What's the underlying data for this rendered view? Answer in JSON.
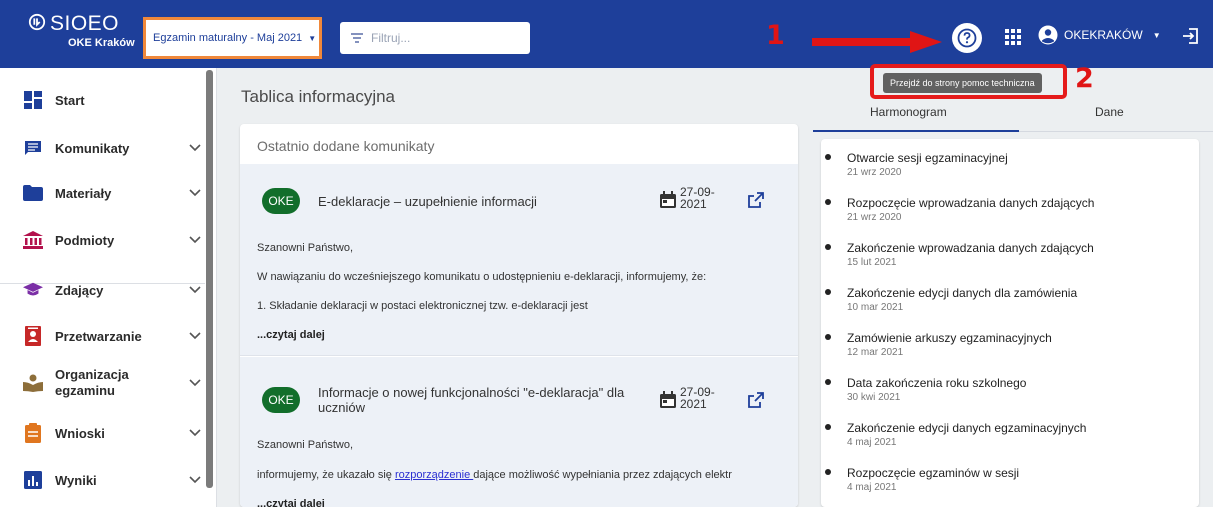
{
  "header": {
    "logo_title": "SIOEO",
    "logo_subtitle": "OKE Kraków",
    "exam_select": "Egzamin maturalny - Maj 2021",
    "filter_placeholder": "Filtruj...",
    "user_label": "OKEKRAKÓW",
    "annotation_1": "1",
    "annotation_2": "2",
    "help_tooltip": "Przejdź do strony pomoc techniczna",
    "colors": {
      "bar": "#1e3f9a",
      "highlight": "#e51b1b",
      "select_border": "#f0883a"
    }
  },
  "sidebar": {
    "items": [
      {
        "label": "Start",
        "icon": "dashboard-icon"
      },
      {
        "label": "Komunikaty",
        "icon": "message-icon"
      },
      {
        "label": "Materiały",
        "icon": "folder-icon"
      },
      {
        "label": "Podmioty",
        "icon": "institution-icon"
      },
      {
        "label": "Zdający",
        "icon": "graduation-cap-icon"
      },
      {
        "label": "Przetwarzanie",
        "icon": "contact-card-icon"
      },
      {
        "label": "Organizacja egzaminu",
        "label_line1": "Organizacja",
        "label_line2": "egzaminu",
        "icon": "reader-icon"
      },
      {
        "label": "Wnioski",
        "icon": "clipboard-icon"
      },
      {
        "label": "Wyniki",
        "icon": "bar-chart-icon"
      }
    ]
  },
  "main": {
    "page_title": "Tablica informacyjna",
    "panel_title": "Ostatnio dodane komunikaty",
    "cards": [
      {
        "badge": "OKE",
        "title": "E-deklaracje – uzupełnienie informacji",
        "date_line1": "27-09-",
        "date_line2": "2021",
        "lines": [
          "Szanowni Państwo,",
          "W nawiązaniu do wcześniejszego komunikatu o udostępnieniu e-deklaracji, informujemy, że:",
          "1. Składanie deklaracji w postaci elektronicznej tzw. e-deklaracji jest"
        ],
        "read_more": "...czytaj dalej"
      },
      {
        "badge": "OKE",
        "title_line1": "Informacje o nowej funkcjonalności \"e-deklaracja\" dla",
        "title_line2": "uczniów",
        "date_line1": "27-09-",
        "date_line2": "2021",
        "line1": "Szanowni Państwo,",
        "line2_before": "informujemy, że ukazało się ",
        "line2_link": "rozporządzenie ",
        "line2_after": "dające możliwość wypełniania przez zdających elektr",
        "read_more": "...czytaj dalej"
      }
    ]
  },
  "schedule": {
    "tabs": [
      "Harmonogram",
      "Dane"
    ],
    "items": [
      {
        "name": "Otwarcie sesji egzaminacyjnej",
        "date": "21 wrz 2020"
      },
      {
        "name": "Rozpoczęcie wprowadzania danych zdających",
        "date": "21 wrz 2020"
      },
      {
        "name": "Zakończenie wprowadzania danych zdających",
        "date": "15 lut 2021"
      },
      {
        "name": "Zakończenie edycji danych dla zamówienia",
        "date": "10 mar 2021"
      },
      {
        "name": "Zamówienie arkuszy egzaminacyjnych",
        "date": "12 mar 2021"
      },
      {
        "name": "Data zakończenia roku szkolnego",
        "date": "30 kwi 2021"
      },
      {
        "name": "Zakończenie edycji danych egzaminacyjnych",
        "date": "4 maj 2021"
      },
      {
        "name": "Rozpoczęcie egzaminów w sesji",
        "date": "4 maj 2021"
      }
    ]
  }
}
